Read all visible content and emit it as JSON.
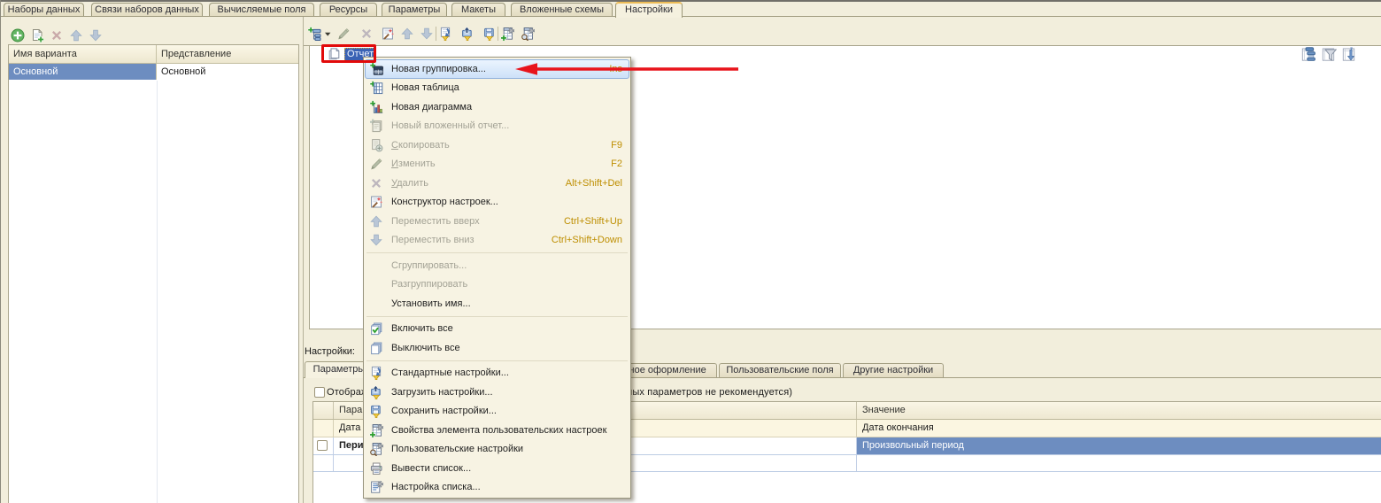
{
  "top_tabs": [
    {
      "label": "Наборы данных",
      "active": false
    },
    {
      "label": "Связи наборов данных",
      "active": false
    },
    {
      "label": "Вычисляемые поля",
      "active": false
    },
    {
      "label": "Ресурсы",
      "active": false
    },
    {
      "label": "Параметры",
      "active": false
    },
    {
      "label": "Макеты",
      "active": false
    },
    {
      "label": "Вложенные схемы",
      "active": false
    },
    {
      "label": "Настройки",
      "active": true
    }
  ],
  "variants_panel": {
    "toolbar": [
      {
        "name": "add-variant-button",
        "icon": "add-circle",
        "enabled": true
      },
      {
        "name": "add-variant-copy-button",
        "icon": "add-copy",
        "enabled": true
      },
      {
        "name": "delete-variant-button",
        "icon": "delete-x-dis",
        "enabled": false
      },
      {
        "name": "move-variant-up-button",
        "icon": "arrow-up-dis",
        "enabled": false
      },
      {
        "name": "move-variant-down-button",
        "icon": "arrow-down-dis",
        "enabled": false
      }
    ],
    "table": {
      "columns": [
        "Имя варианта",
        "Представление"
      ],
      "rows": [
        {
          "name": "Основной",
          "presentation": "Основной",
          "selected": true
        }
      ]
    }
  },
  "tree_panel": {
    "toolbar": [
      {
        "name": "add-setting-item-button",
        "icon": "add-group-dd",
        "enabled": true
      },
      {
        "name": "edit-button",
        "icon": "pencil-dis",
        "enabled": false
      },
      {
        "name": "delete-button",
        "icon": "x-dis",
        "enabled": false
      },
      {
        "name": "settings-wizard-button",
        "icon": "wizard",
        "enabled": true
      },
      {
        "name": "move-up-button",
        "icon": "arrow-up-dis",
        "enabled": false
      },
      {
        "name": "move-down-button",
        "icon": "arrow-down-dis",
        "enabled": false
      },
      {
        "name": "sep"
      },
      {
        "name": "standard-settings-button",
        "icon": "std-settings",
        "enabled": true
      },
      {
        "name": "load-settings-button",
        "icon": "load-settings",
        "enabled": true
      },
      {
        "name": "save-settings-button",
        "icon": "save-settings",
        "enabled": true
      },
      {
        "name": "sep"
      },
      {
        "name": "user-setting-props-button",
        "icon": "props-settings",
        "enabled": true
      },
      {
        "name": "user-settings-button",
        "icon": "user-settings",
        "enabled": true
      }
    ],
    "root_node": {
      "label": "Отчет",
      "icon": "report",
      "selected": true
    },
    "corner_buttons": [
      {
        "name": "view-structure-button",
        "icon": "view-structure"
      },
      {
        "name": "view-filter-button",
        "icon": "view-filter"
      },
      {
        "name": "view-sort-button",
        "icon": "view-sort"
      }
    ]
  },
  "context_menu": {
    "items": [
      {
        "label": "Новая группировка...",
        "shortcut": "Ins",
        "icon": "new-group",
        "highlighted": true
      },
      {
        "label": "Новая таблица",
        "icon": "new-table"
      },
      {
        "label": "Новая диаграмма",
        "icon": "new-chart"
      },
      {
        "label": "Новый вложенный отчет...",
        "icon": "nested-dis",
        "disabled": true
      },
      {
        "label": "Скопировать",
        "shortcut": "F9",
        "icon": "copy-dis",
        "disabled": true,
        "mnemonic": true
      },
      {
        "label": "Изменить",
        "shortcut": "F2",
        "icon": "pencil-dis",
        "disabled": true,
        "mnemonic": true
      },
      {
        "label": "Удалить",
        "shortcut": "Alt+Shift+Del",
        "icon": "x-dis",
        "disabled": true,
        "mnemonic": true
      },
      {
        "label": "Конструктор настроек...",
        "icon": "wizard"
      },
      {
        "label": "Переместить вверх",
        "shortcut": "Ctrl+Shift+Up",
        "icon": "arrow-up-dis",
        "disabled": true
      },
      {
        "label": "Переместить вниз",
        "shortcut": "Ctrl+Shift+Down",
        "icon": "arrow-down-dis",
        "disabled": true
      },
      {
        "separator": true
      },
      {
        "label": "Сгруппировать...",
        "disabled": true
      },
      {
        "label": "Разгруппировать",
        "disabled": true
      },
      {
        "label": "Установить имя..."
      },
      {
        "separator": true
      },
      {
        "label": "Включить все",
        "icon": "enable-all"
      },
      {
        "label": "Выключить все",
        "icon": "disable-all"
      },
      {
        "separator": true
      },
      {
        "label": "Стандартные настройки...",
        "icon": "std-settings"
      },
      {
        "label": "Загрузить настройки...",
        "icon": "load-settings"
      },
      {
        "label": "Сохранить настройки...",
        "icon": "save-settings"
      },
      {
        "label": "Свойства элемента пользовательских настроек",
        "icon": "props-settings"
      },
      {
        "label": "Пользовательские настройки",
        "icon": "user-settings"
      },
      {
        "label": "Вывести список...",
        "icon": "print-list"
      },
      {
        "label": "Настройка списка...",
        "icon": "list-cfg"
      }
    ]
  },
  "settings_panel": {
    "label": "Настройки:",
    "tabs": [
      {
        "label": "Параметры",
        "active": true
      },
      {
        "label": "Условное оформление",
        "active": false
      },
      {
        "label": "Пользовательские поля",
        "active": false
      },
      {
        "label": "Другие настройки",
        "active": false
      }
    ],
    "show_unavailable_checkbox": {
      "checked": false,
      "label": "Отображать недоступные параметры (выбор значений недоступных параметров не рекомендуется)"
    },
    "table": {
      "columns": [
        "Параметр",
        "Значение"
      ],
      "rows": [
        {
          "parameter": "Дата окончания",
          "value": "Дата окончания",
          "style": "unavailable"
        },
        {
          "parameter": "Период",
          "value": "Произвольный период",
          "style": "param",
          "checkbox_checked": false,
          "value_selected": true
        },
        {
          "parameter": "",
          "value": "",
          "style": "empty"
        }
      ]
    }
  },
  "annotations": {
    "box_color": "#E20A0A",
    "arrow_color": "#E8141C"
  },
  "colors": {
    "background": "#F2EEDC",
    "selection_blue": "#6D8DC0",
    "tree_selection_blue": "#3A62B4",
    "shortcut_text": "#BE8E00",
    "menu_background": "#F7F3E3"
  }
}
